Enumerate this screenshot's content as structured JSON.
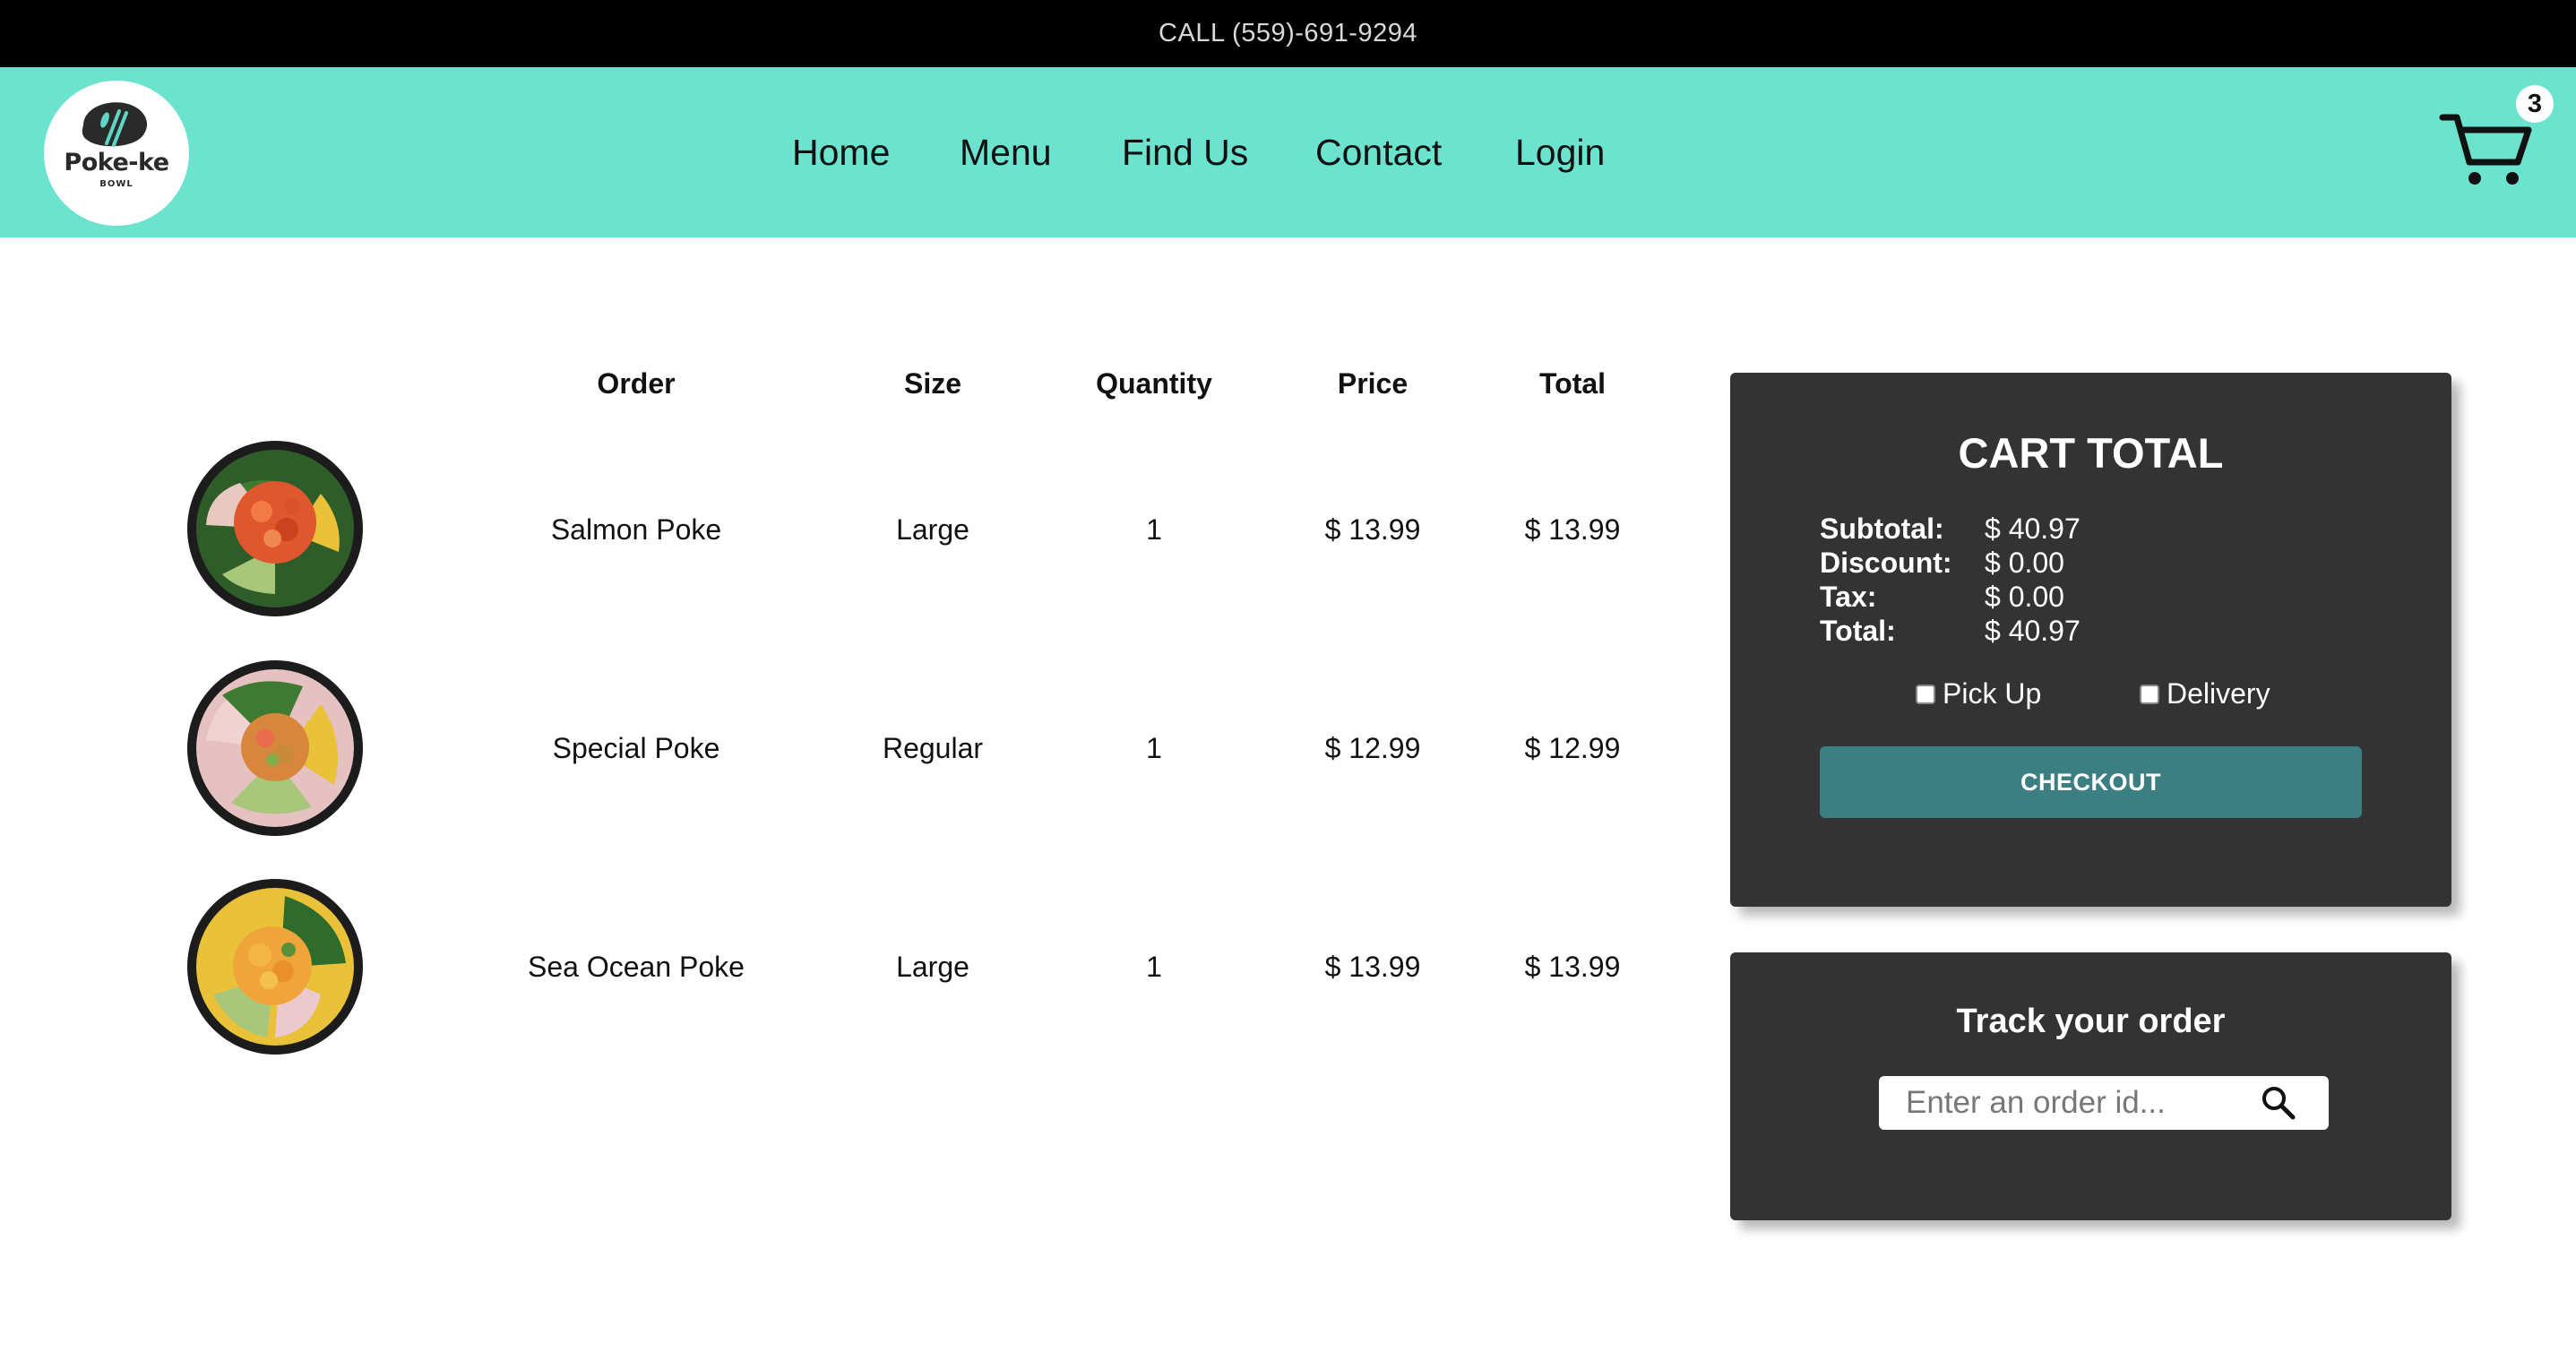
{
  "topbar": {
    "call_text": "CALL (559)-691-9294"
  },
  "brand": {
    "name": "Poke-ke",
    "subtitle": "BOWL"
  },
  "nav": {
    "items": [
      {
        "label": "Home"
      },
      {
        "label": "Menu"
      },
      {
        "label": "Find Us"
      },
      {
        "label": "Contact"
      },
      {
        "label": "Login"
      }
    ]
  },
  "cart_badge": {
    "count": "3"
  },
  "table": {
    "headers": {
      "order": "Order",
      "size": "Size",
      "quantity": "Quantity",
      "price": "Price",
      "total": "Total"
    },
    "rows": [
      {
        "name": "Salmon Poke",
        "size": "Large",
        "quantity": "1",
        "price": "$ 13.99",
        "total": "$ 13.99",
        "image": "salmon-poke-bowl"
      },
      {
        "name": "Special Poke",
        "size": "Regular",
        "quantity": "1",
        "price": "$ 12.99",
        "total": "$ 12.99",
        "image": "special-poke-bowl"
      },
      {
        "name": "Sea Ocean Poke",
        "size": "Large",
        "quantity": "1",
        "price": "$ 13.99",
        "total": "$ 13.99",
        "image": "sea-ocean-poke-bowl"
      }
    ]
  },
  "cart_total": {
    "title": "CART TOTAL",
    "lines": [
      {
        "label": "Subtotal:",
        "value": "$ 40.97"
      },
      {
        "label": "Discount:",
        "value": "$ 0.00"
      },
      {
        "label": "Tax:",
        "value": "$ 0.00"
      },
      {
        "label": "Total:",
        "value": "$ 40.97"
      }
    ],
    "options": [
      {
        "label": "Pick Up",
        "checked": false
      },
      {
        "label": "Delivery",
        "checked": false
      }
    ],
    "checkout_label": "CHECKOUT"
  },
  "track": {
    "title": "Track your order",
    "placeholder": "Enter an order id...",
    "value": ""
  },
  "colors": {
    "nav_bg": "#6be3cf",
    "topbar_bg": "#000000",
    "panel_bg": "#333333",
    "checkout_bg": "#3c7f83",
    "logo_mark": "#2a2a2a",
    "logo_accent": "#5fd6c4"
  },
  "icons": {
    "cart": "shopping-cart-icon",
    "search": "search-icon",
    "logo": "poke-bowl-logo"
  }
}
